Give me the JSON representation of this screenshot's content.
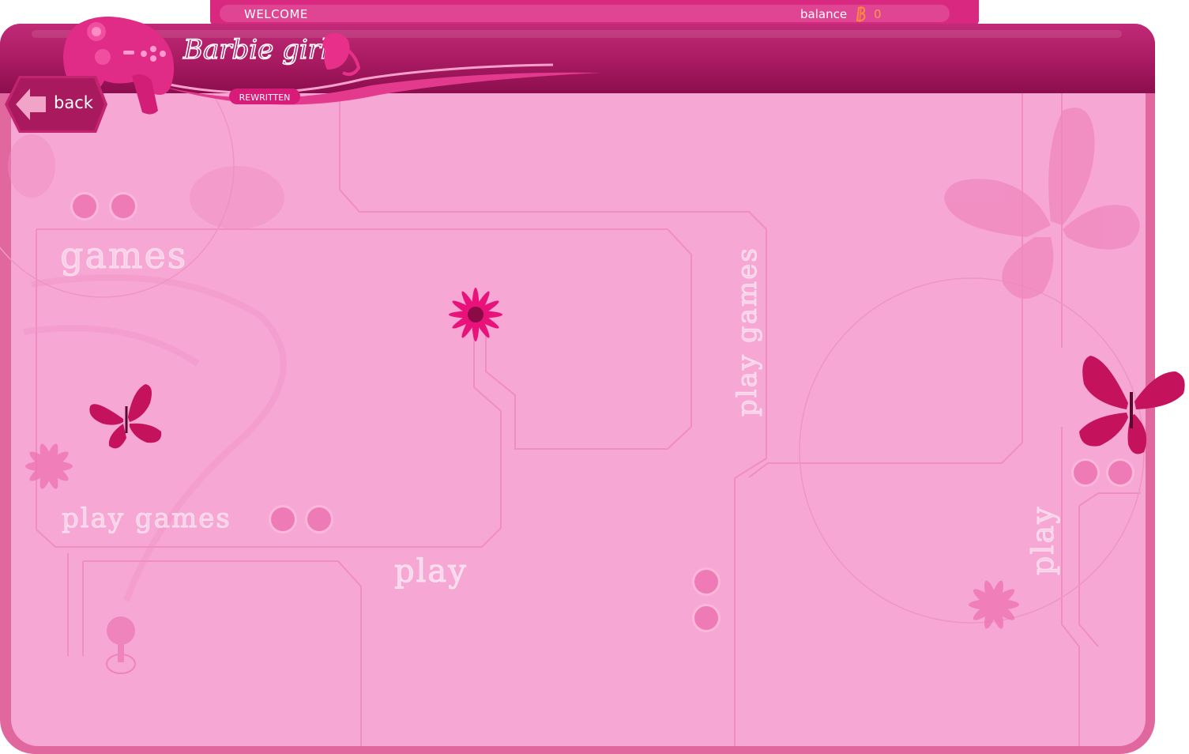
{
  "top_bar": {
    "welcome_text": "WELCOME",
    "balance_label": "balance",
    "balance_value": "0",
    "balance_icon": "barbie-b-coin-icon"
  },
  "logo": {
    "brand": "Barbie girls",
    "subtitle": "REWRITTEN"
  },
  "navigation": {
    "back_label": "back"
  },
  "room": {
    "labels": [
      "games",
      "play games",
      "play",
      "play games",
      "play"
    ]
  },
  "colors": {
    "accent": "#d8287f",
    "header": "#a81a62",
    "panel": "#f6a7d4",
    "butterfly": "#c4125c",
    "flower": "#e8127a",
    "balance_value": "#ff9a4a"
  }
}
